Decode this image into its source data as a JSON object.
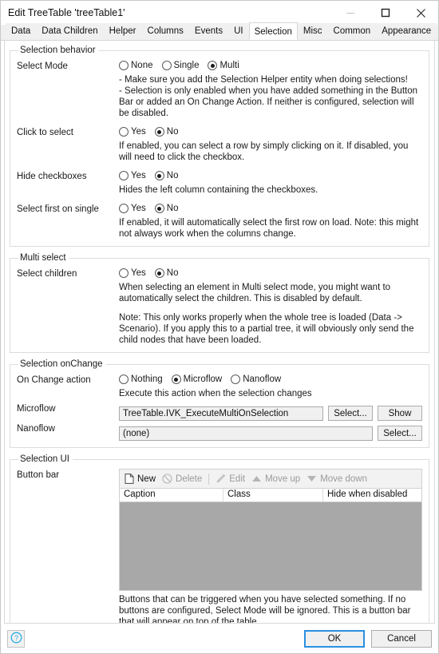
{
  "window": {
    "title": "Edit TreeTable 'treeTable1'",
    "controls": {
      "minimize": "minimize-icon",
      "maximize": "maximize-icon",
      "close": "close-icon"
    }
  },
  "tabs": [
    {
      "label": "Data",
      "active": false
    },
    {
      "label": "Data Children",
      "active": false
    },
    {
      "label": "Helper",
      "active": false
    },
    {
      "label": "Columns",
      "active": false
    },
    {
      "label": "Events",
      "active": false
    },
    {
      "label": "UI",
      "active": false
    },
    {
      "label": "Selection",
      "active": true
    },
    {
      "label": "Misc",
      "active": false
    },
    {
      "label": "Common",
      "active": false
    },
    {
      "label": "Appearance",
      "active": false
    }
  ],
  "selection_behavior": {
    "legend": "Selection behavior",
    "select_mode": {
      "label": "Select Mode",
      "options": [
        "None",
        "Single",
        "Multi"
      ],
      "selected": "Multi",
      "help_lines": [
        "- Make sure you add the Selection Helper entity when doing selections!",
        "- Selection is only enabled when you have added something in the Button Bar or added an On Change Action. If neither is configured, selection will be disabled."
      ]
    },
    "click_to_select": {
      "label": "Click to select",
      "options": [
        "Yes",
        "No"
      ],
      "selected": "No",
      "help": "If enabled, you can select a row by simply clicking on it. If disabled, you will need to click the checkbox."
    },
    "hide_checkboxes": {
      "label": "Hide checkboxes",
      "options": [
        "Yes",
        "No"
      ],
      "selected": "No",
      "help": "Hides the left column containing the checkboxes."
    },
    "select_first_on_single": {
      "label": "Select first on single",
      "options": [
        "Yes",
        "No"
      ],
      "selected": "No",
      "help": "If enabled, it will automatically select the first row on load. Note: this might not always work when the columns change."
    }
  },
  "multi_select": {
    "legend": "Multi select",
    "select_children": {
      "label": "Select children",
      "options": [
        "Yes",
        "No"
      ],
      "selected": "No",
      "help_1": "When selecting an element in Multi select mode, you might want to automatically select the children. This is disabled by default.",
      "help_2": "Note: This only works properly when the whole tree is loaded (Data -> Scenario). If you apply this to a partial tree, it will obviously only send the child nodes that have been loaded."
    }
  },
  "selection_onchange": {
    "legend": "Selection onChange",
    "on_change_action": {
      "label": "On Change action",
      "options": [
        "Nothing",
        "Microflow",
        "Nanoflow"
      ],
      "selected": "Microflow",
      "help": "Execute this action when the selection changes"
    },
    "microflow": {
      "label": "Microflow",
      "value": "TreeTable.IVK_ExecuteMultiOnSelection",
      "select_button": "Select...",
      "show_button": "Show"
    },
    "nanoflow": {
      "label": "Nanoflow",
      "value": "(none)",
      "select_button": "Select..."
    }
  },
  "selection_ui": {
    "legend": "Selection UI",
    "button_bar": {
      "label": "Button bar",
      "toolbar": [
        {
          "label": "New",
          "icon": "new-page-icon",
          "disabled": false
        },
        {
          "label": "Delete",
          "icon": "delete-circle-slash-icon",
          "disabled": true
        },
        {
          "label": "Edit",
          "icon": "edit-pencil-icon",
          "disabled": true
        },
        {
          "label": "Move up",
          "icon": "triangle-up-icon",
          "disabled": true
        },
        {
          "label": "Move down",
          "icon": "triangle-down-icon",
          "disabled": true
        }
      ],
      "columns": [
        "Caption",
        "Class",
        "Hide when disabled"
      ],
      "rows": [],
      "help": "Buttons that can be triggered when you have selected something. If no buttons are configured, Select Mode will be ignored. This is a button bar that will appear on top of the table."
    }
  },
  "footer": {
    "help_icon": "help-question-icon",
    "ok": "OK",
    "cancel": "Cancel"
  },
  "colors": {
    "accent": "#2a8fe0",
    "list_body": "#a8a8a8",
    "disabled_text": "#9a9a9a"
  }
}
